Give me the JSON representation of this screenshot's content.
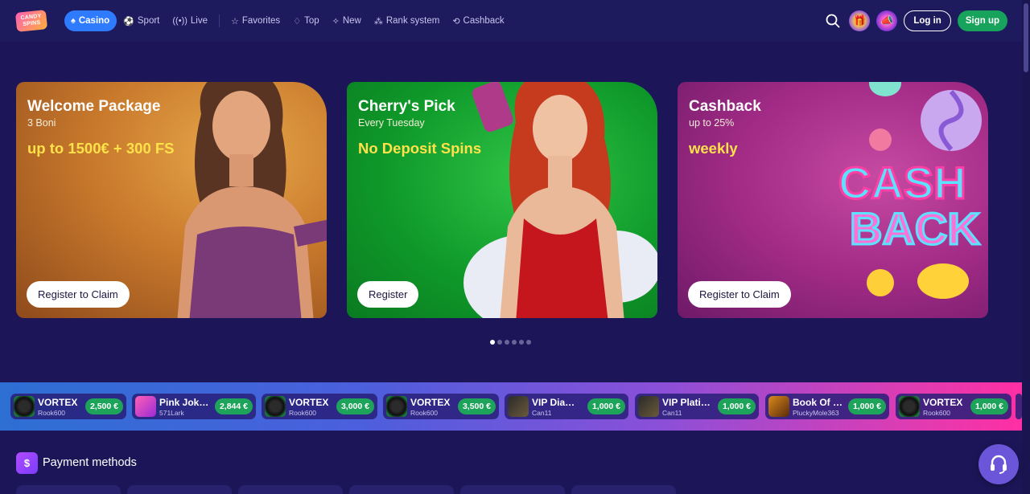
{
  "brand": {
    "logo_line1": "CANDY",
    "logo_line2": "SPINS"
  },
  "nav": [
    {
      "label": "Casino",
      "icon": "spade-icon"
    },
    {
      "label": "Sport",
      "icon": "ball-icon"
    },
    {
      "label": "Live",
      "icon": "live-icon"
    },
    {
      "label": "Favorites",
      "icon": "star-icon"
    },
    {
      "label": "Top",
      "icon": "flame-icon"
    },
    {
      "label": "New",
      "icon": "sparkle-icon"
    },
    {
      "label": "Rank system",
      "icon": "rank-icon"
    },
    {
      "label": "Cashback",
      "icon": "cashback-icon"
    }
  ],
  "header": {
    "login_label": "Log in",
    "signup_label": "Sign up"
  },
  "banners": [
    {
      "title": "Welcome Package",
      "subtitle": "3 Boni",
      "offer": "up to 1500€ + 300 FS",
      "button": "Register to Claim"
    },
    {
      "title": "Cherry's Pick",
      "subtitle": "Every Tuesday",
      "offer": "No Deposit Spins",
      "button": "Register"
    },
    {
      "title": "Cashback",
      "subtitle": "up to 25%",
      "offer": "weekly",
      "button": "Register to Claim",
      "art_line1": "CASH",
      "art_line2": "BACK"
    }
  ],
  "carousel": {
    "slides": 6,
    "active": 0
  },
  "wins": [
    {
      "game": "VORTEX",
      "user": "Rook600",
      "amount": "2,500 €",
      "thumb": "vortex"
    },
    {
      "game": "Pink Jok…",
      "user": "571Lark",
      "amount": "2,844 €",
      "thumb": "pink"
    },
    {
      "game": "VORTEX",
      "user": "Rook600",
      "amount": "3,000 €",
      "thumb": "vortex"
    },
    {
      "game": "VORTEX",
      "user": "Rook600",
      "amount": "3,500 €",
      "thumb": "vortex"
    },
    {
      "game": "VIP Diam…",
      "user": "Can11",
      "amount": "1,000 €",
      "thumb": "vip"
    },
    {
      "game": "VIP Plati…",
      "user": "Can11",
      "amount": "1,000 €",
      "thumb": "vip"
    },
    {
      "game": "Book Of …",
      "user": "PluckyMole363",
      "amount": "1,000 €",
      "thumb": "book"
    },
    {
      "game": "VORTEX",
      "user": "Rook600",
      "amount": "1,000 €",
      "thumb": "vortex"
    }
  ],
  "payments": {
    "title": "Payment methods"
  },
  "colors": {
    "bg": "#1c1659",
    "accent": "#2f7bff",
    "signup": "#17a35b",
    "offer": "#ffe14a"
  }
}
